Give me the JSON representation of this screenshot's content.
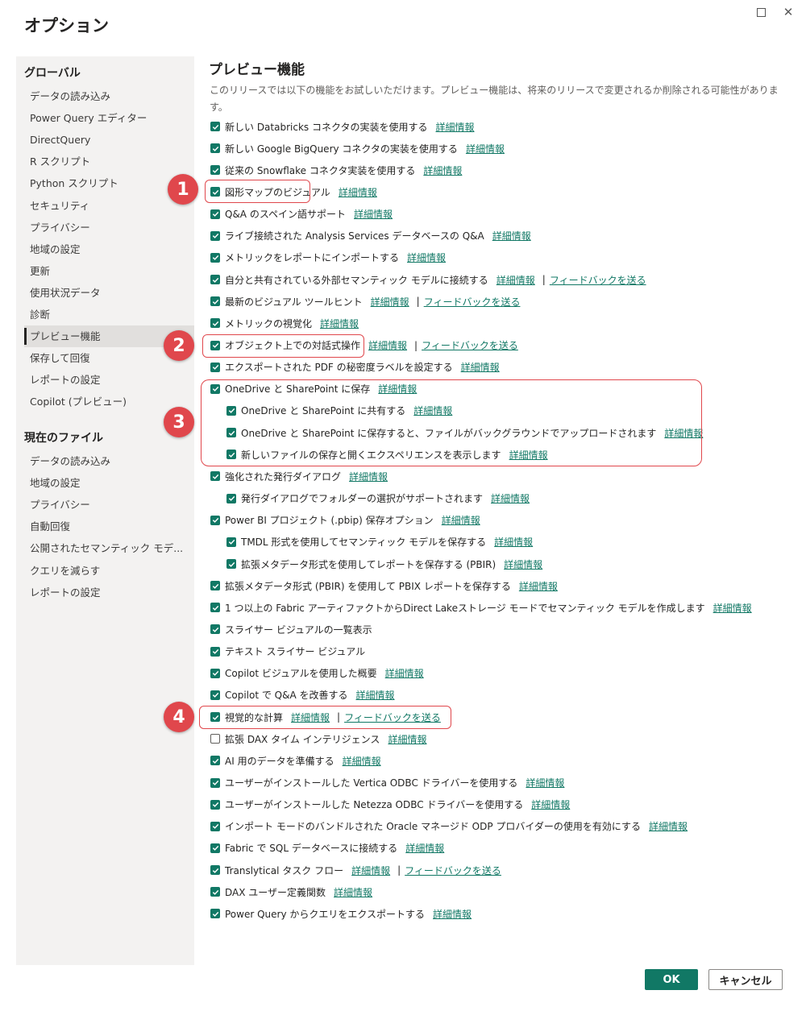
{
  "dialog": {
    "title": "オプション"
  },
  "sidebar": {
    "global_header": "グローバル",
    "global_items": [
      {
        "label": "データの読み込み"
      },
      {
        "label": "Power Query エディター"
      },
      {
        "label": "DirectQuery"
      },
      {
        "label": "R スクリプト"
      },
      {
        "label": "Python スクリプト"
      },
      {
        "label": "セキュリティ"
      },
      {
        "label": "プライバシー"
      },
      {
        "label": "地域の設定"
      },
      {
        "label": "更新"
      },
      {
        "label": "使用状況データ"
      },
      {
        "label": "診断"
      },
      {
        "label": "プレビュー機能",
        "active": true
      },
      {
        "label": "保存して回復"
      },
      {
        "label": "レポートの設定"
      },
      {
        "label": "Copilot (プレビュー)"
      }
    ],
    "file_header": "現在のファイル",
    "file_items": [
      {
        "label": "データの読み込み"
      },
      {
        "label": "地域の設定"
      },
      {
        "label": "プライバシー"
      },
      {
        "label": "自動回復"
      },
      {
        "label": "公開されたセマンティック モデ..."
      },
      {
        "label": "クエリを減らす"
      },
      {
        "label": "レポートの設定"
      }
    ]
  },
  "main": {
    "title": "プレビュー機能",
    "description": "このリリースでは以下の機能をお試しいただけます。プレビュー機能は、将来のリリースで変更されるか削除される可能性があります。",
    "options": [
      {
        "label": "新しい Databricks コネクタの実装を使用する",
        "checked": true,
        "indent": 0,
        "link": "詳細情報"
      },
      {
        "label": "新しい Google BigQuery コネクタの実装を使用する",
        "checked": true,
        "indent": 0,
        "link": "詳細情報"
      },
      {
        "label": "従来の Snowflake コネクタ実装を使用する",
        "checked": true,
        "indent": 0,
        "link": "詳細情報"
      },
      {
        "label": "図形マップのビジュアル",
        "checked": true,
        "indent": 0,
        "link": "詳細情報"
      },
      {
        "label": "Q&A のスペイン語サポート",
        "checked": true,
        "indent": 0,
        "link": "詳細情報"
      },
      {
        "label": "ライブ接続された Analysis Services データベースの Q&A",
        "checked": true,
        "indent": 0,
        "link": "詳細情報"
      },
      {
        "label": "メトリックをレポートにインポートする",
        "checked": true,
        "indent": 0,
        "link": "詳細情報"
      },
      {
        "label": "自分と共有されている外部セマンティック モデルに接続する",
        "checked": true,
        "indent": 0,
        "link": "詳細情報",
        "feedback": "フィードバックを送る"
      },
      {
        "label": "最新のビジュアル ツールヒント",
        "checked": true,
        "indent": 0,
        "link": "詳細情報",
        "feedback": "フィードバックを送る"
      },
      {
        "label": "メトリックの視覚化",
        "checked": true,
        "indent": 0,
        "link": "詳細情報"
      },
      {
        "label": "オブジェクト上での対話式操作",
        "checked": true,
        "indent": 0,
        "link": "詳細情報",
        "feedback": "フィードバックを送る"
      },
      {
        "label": "エクスポートされた PDF の秘密度ラベルを設定する",
        "checked": true,
        "indent": 0,
        "link": "詳細情報"
      },
      {
        "label": "OneDrive と SharePoint に保存",
        "checked": true,
        "indent": 0,
        "link": "詳細情報"
      },
      {
        "label": "OneDrive と SharePoint に共有する",
        "checked": true,
        "indent": 1,
        "link": "詳細情報"
      },
      {
        "label": "OneDrive と SharePoint に保存すると、ファイルがバックグラウンドでアップロードされます",
        "checked": true,
        "indent": 1,
        "link": "詳細情報"
      },
      {
        "label": "新しいファイルの保存と開くエクスペリエンスを表示します",
        "checked": true,
        "indent": 1,
        "link": "詳細情報"
      },
      {
        "label": "強化された発行ダイアログ",
        "checked": true,
        "indent": 0,
        "link": "詳細情報"
      },
      {
        "label": "発行ダイアログでフォルダーの選択がサポートされます",
        "checked": true,
        "indent": 1,
        "link": "詳細情報"
      },
      {
        "label": "Power BI プロジェクト (.pbip) 保存オプション",
        "checked": true,
        "indent": 0,
        "link": "詳細情報"
      },
      {
        "label": "TMDL 形式を使用してセマンティック モデルを保存する",
        "checked": true,
        "indent": 1,
        "link": "詳細情報"
      },
      {
        "label": "拡張メタデータ形式を使用してレポートを保存する (PBIR)",
        "checked": true,
        "indent": 1,
        "link": "詳細情報"
      },
      {
        "label": "拡張メタデータ形式 (PBIR) を使用して PBIX レポートを保存する",
        "checked": true,
        "indent": 0,
        "link": "詳細情報"
      },
      {
        "label": "1 つ以上の Fabric アーティファクトからDirect Lakeストレージ モードでセマンティック モデルを作成します",
        "checked": true,
        "indent": 0,
        "link": "詳細情報"
      },
      {
        "label": "スライサー ビジュアルの一覧表示",
        "checked": true,
        "indent": 0
      },
      {
        "label": "テキスト スライサー ビジュアル",
        "checked": true,
        "indent": 0
      },
      {
        "label": "Copilot ビジュアルを使用した概要",
        "checked": true,
        "indent": 0,
        "link": "詳細情報"
      },
      {
        "label": "Copilot で Q&A を改善する",
        "checked": true,
        "indent": 0,
        "link": "詳細情報"
      },
      {
        "label": "視覚的な計算",
        "checked": true,
        "indent": 0,
        "link": "詳細情報",
        "feedback": "フィードバックを送る"
      },
      {
        "label": "拡張 DAX タイム インテリジェンス",
        "checked": false,
        "indent": 0,
        "link": "詳細情報"
      },
      {
        "label": "AI 用のデータを準備する",
        "checked": true,
        "indent": 0,
        "link": "詳細情報"
      },
      {
        "label": "ユーザーがインストールした Vertica ODBC ドライバーを使用する",
        "checked": true,
        "indent": 0,
        "link": "詳細情報"
      },
      {
        "label": "ユーザーがインストールした Netezza ODBC ドライバーを使用する",
        "checked": true,
        "indent": 0,
        "link": "詳細情報"
      },
      {
        "label": "インポート モードのバンドルされた Oracle マネージド ODP プロバイダーの使用を有効にする",
        "checked": true,
        "indent": 0,
        "link": "詳細情報"
      },
      {
        "label": "Fabric で SQL データベースに接続する",
        "checked": true,
        "indent": 0,
        "link": "詳細情報"
      },
      {
        "label": "Translytical タスク フロー",
        "checked": true,
        "indent": 0,
        "link": "詳細情報",
        "feedback": "フィードバックを送る"
      },
      {
        "label": "DAX ユーザー定義関数",
        "checked": true,
        "indent": 0,
        "link": "詳細情報"
      },
      {
        "label": "Power Query からクエリをエクスポートする",
        "checked": true,
        "indent": 0,
        "link": "詳細情報"
      }
    ]
  },
  "annotations": {
    "color": "#e0474c",
    "badges": [
      "1",
      "2",
      "3",
      "4"
    ]
  },
  "buttons": {
    "ok": "OK",
    "cancel": "キャンセル"
  },
  "colors": {
    "accent": "#117865",
    "sidebar_bg": "#f3f2f1"
  }
}
